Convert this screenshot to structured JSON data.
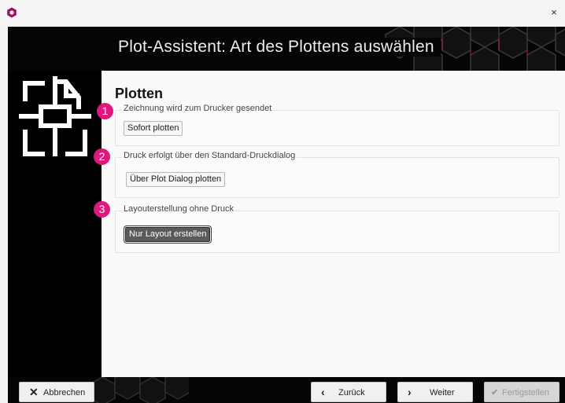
{
  "window": {
    "app_icon": "app-logo-icon",
    "close_glyph": "×"
  },
  "header": {
    "title": "Plot-Assistent: Art des Plottens auswählen"
  },
  "sidebar": {
    "logo_icon": "plot-document-frame-icon"
  },
  "content": {
    "section_title": "Plotten",
    "groups": [
      {
        "badge": "1",
        "label": "Zeichnung wird zum Drucker gesendet",
        "button": "Sofort plotten"
      },
      {
        "badge": "2",
        "label": "Druck erfolgt über den Standard-Druckdialog",
        "button": "Über Plot Dialog plotten"
      },
      {
        "badge": "3",
        "label": "Layouterstellung ohne Druck",
        "button": "Nur Layout erstellen",
        "selected": true
      }
    ]
  },
  "footer": {
    "cancel": {
      "label": "Abbrechen",
      "icon": "close-icon"
    },
    "back": {
      "label": "Zurück",
      "icon": "chevron-left-icon"
    },
    "next": {
      "label": "Weiter",
      "icon": "chevron-right-icon"
    },
    "finish": {
      "label": "Fertigstellen",
      "icon": "checkmark-icon",
      "disabled": true
    }
  },
  "colors": {
    "accent": "#e0177e",
    "header_bg": "#050505",
    "hex_outline": "#c8166e"
  }
}
